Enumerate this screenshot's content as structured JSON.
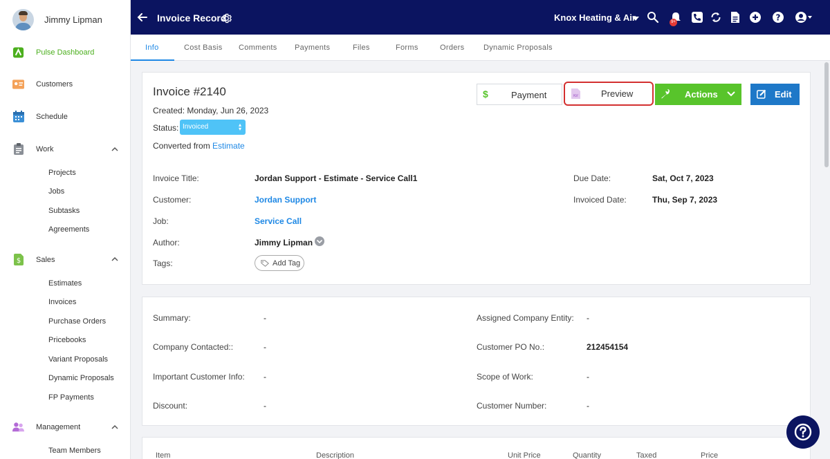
{
  "sidebar": {
    "user_name": "Jimmy Lipman",
    "items": [
      {
        "label": "Pulse Dashboard"
      },
      {
        "label": "Customers"
      },
      {
        "label": "Schedule"
      },
      {
        "label": "Work"
      },
      {
        "label": "Sales"
      },
      {
        "label": "Management"
      }
    ],
    "work_sub": [
      "Projects",
      "Jobs",
      "Subtasks",
      "Agreements"
    ],
    "sales_sub": [
      "Estimates",
      "Invoices",
      "Purchase Orders",
      "Pricebooks",
      "Variant Proposals",
      "Dynamic Proposals",
      "FP Payments"
    ],
    "management_sub": [
      "Team Members"
    ]
  },
  "header": {
    "title": "Invoice Record",
    "company": "Knox Heating & Air",
    "notification_count": "9+"
  },
  "tabs": [
    "Info",
    "Cost Basis",
    "Comments",
    "Payments",
    "Files",
    "Forms",
    "Orders",
    "Dynamic Proposals"
  ],
  "invoice": {
    "title": "Invoice #2140",
    "created": "Created: Monday, Jun 26, 2023",
    "status_label": "Status:",
    "status_value": "Invoiced",
    "converted_prefix": "Converted from",
    "converted_link": "Estimate"
  },
  "buttons": {
    "payment": "Payment",
    "preview": "Preview",
    "actions": "Actions",
    "edit": "Edit"
  },
  "details": {
    "invoice_title_label": "Invoice Title:",
    "invoice_title_value": "Jordan Support - Estimate - Service Call1",
    "customer_label": "Customer:",
    "customer_value": "Jordan Support",
    "job_label": "Job:",
    "job_value": "Service Call",
    "author_label": "Author:",
    "author_value": "Jimmy Lipman",
    "tags_label": "Tags:",
    "add_tag": "Add Tag",
    "due_date_label": "Due Date:",
    "due_date_value": "Sat, Oct 7, 2023",
    "invoiced_date_label": "Invoiced Date:",
    "invoiced_date_value": "Thu, Sep 7, 2023"
  },
  "extra": {
    "summary_label": "Summary:",
    "summary_value": "-",
    "company_contacted_label": "Company Contacted::",
    "company_contacted_value": "-",
    "important_info_label": "Important Customer Info:",
    "important_info_value": "-",
    "discount_label": "Discount:",
    "discount_value": "-",
    "assigned_entity_label": "Assigned Company Entity:",
    "assigned_entity_value": "-",
    "po_label": "Customer PO No.:",
    "po_value": "212454154",
    "scope_label": "Scope of Work:",
    "scope_value": "-",
    "customer_number_label": "Customer Number:",
    "customer_number_value": "-"
  },
  "table_headers": [
    "Item",
    "Description",
    "Unit Price",
    "Quantity",
    "Taxed",
    "Price"
  ],
  "colors": {
    "brand_nav": "#0b1460",
    "accent_green": "#58c42b",
    "accent_blue": "#1e88e5",
    "highlight_red": "#d32f2f"
  }
}
